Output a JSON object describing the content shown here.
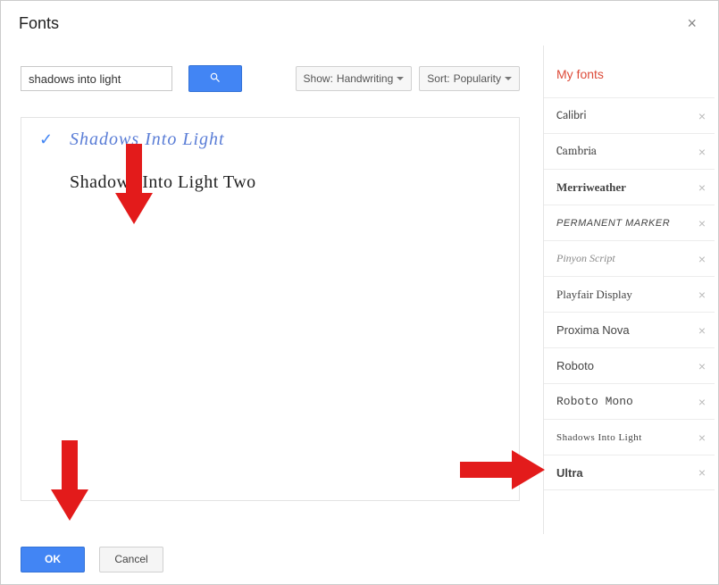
{
  "dialog": {
    "title": "Fonts"
  },
  "search": {
    "value": "shadows into light"
  },
  "filters": {
    "show_prefix": "Show:",
    "show_value": "Handwriting",
    "sort_prefix": "Sort:",
    "sort_value": "Popularity"
  },
  "results": [
    {
      "name": "Shadows Into Light",
      "selected": true,
      "font_class": "font-shadows"
    },
    {
      "name": "Shadows Into Light Two",
      "selected": false,
      "font_class": "font-shadows-two"
    }
  ],
  "sidebar": {
    "heading": "My fonts",
    "items": [
      {
        "name": "Calibri",
        "font_class": "ff-calibri"
      },
      {
        "name": "Cambria",
        "font_class": "ff-cambria"
      },
      {
        "name": "Merriweather",
        "font_class": "ff-merri"
      },
      {
        "name": "Permanent Marker",
        "font_class": "ff-perm"
      },
      {
        "name": "Pinyon Script",
        "font_class": "ff-pinyon"
      },
      {
        "name": "Playfair Display",
        "font_class": "ff-playfair"
      },
      {
        "name": "Proxima Nova",
        "font_class": "ff-proxima"
      },
      {
        "name": "Roboto",
        "font_class": "ff-roboto"
      },
      {
        "name": "Roboto Mono",
        "font_class": "ff-robmono"
      },
      {
        "name": "Shadows Into Light",
        "font_class": "ff-shadowslight"
      },
      {
        "name": "Ultra",
        "font_class": "ff-ultra"
      }
    ]
  },
  "footer": {
    "ok_label": "OK",
    "cancel_label": "Cancel"
  }
}
